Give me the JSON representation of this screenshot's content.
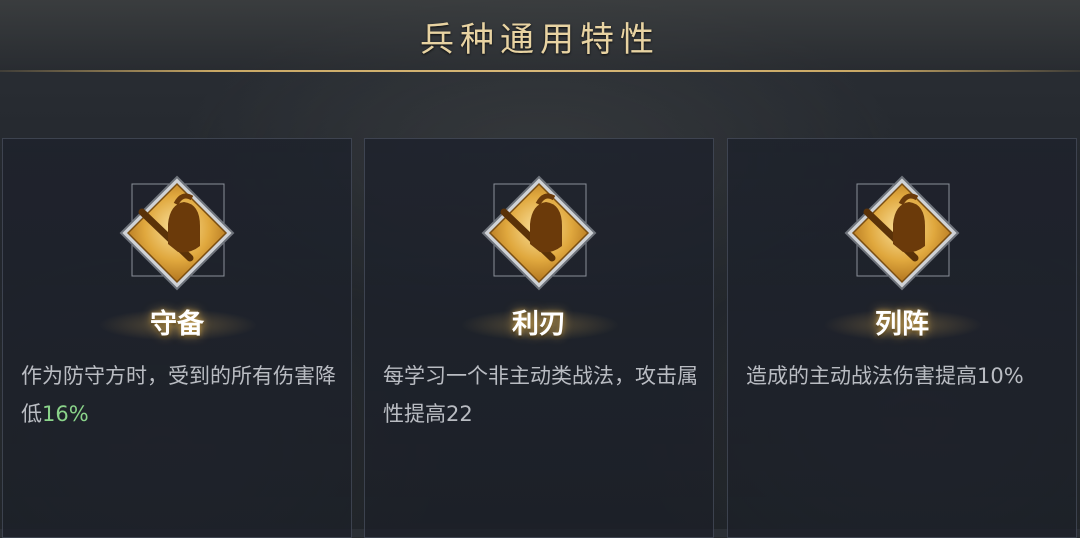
{
  "header": {
    "title": "兵种通用特性"
  },
  "cards": [
    {
      "name": "守备",
      "desc": "作为防守方时，受到的所有伤害降低",
      "value": "16%",
      "icon": "helmet-sword-icon"
    },
    {
      "name": "利刃",
      "desc": "每学习一个非主动类战法，攻击属性提高22",
      "value": "",
      "icon": "helmet-sword-icon"
    },
    {
      "name": "列阵",
      "desc": "造成的主动战法伤害提高10%",
      "value": "",
      "icon": "helmet-sword-icon"
    }
  ],
  "colors": {
    "gold": "#d8b878",
    "highlight": "#8ad38a",
    "text": "#b9bcc2"
  }
}
